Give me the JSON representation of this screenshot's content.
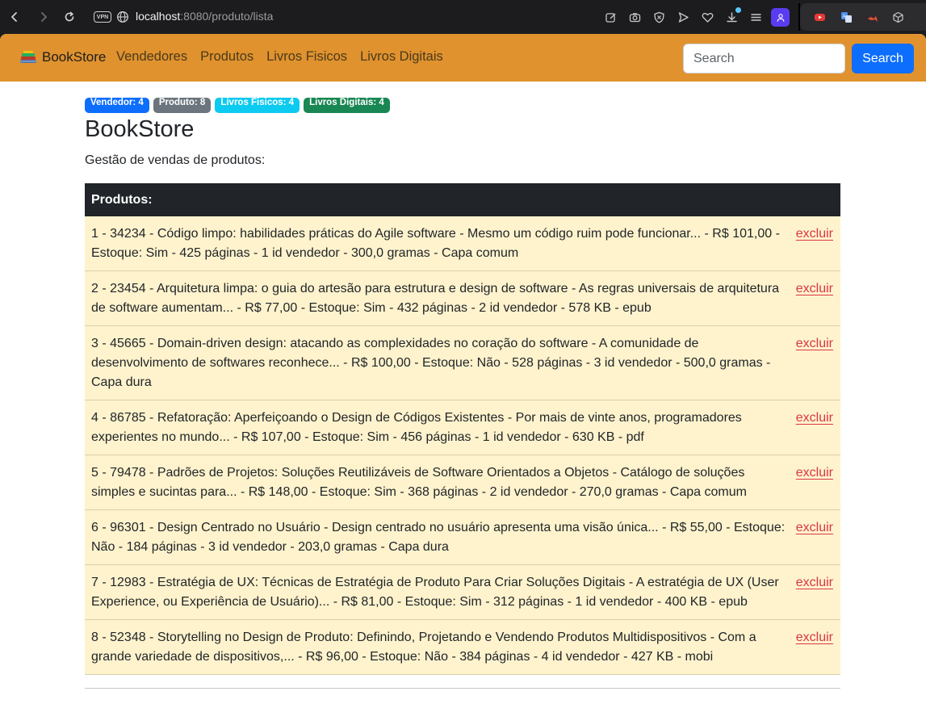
{
  "browser": {
    "vpn_label": "VPN",
    "url_host": "localhost",
    "url_rest": ":8080/produto/lista"
  },
  "navbar": {
    "brand": "BookStore",
    "links": [
      "Vendedores",
      "Produtos",
      "Livros Fisicos",
      "Livros Digitais"
    ],
    "search_placeholder": "Search",
    "search_button": "Search",
    "background": "#e0922e"
  },
  "badges": [
    {
      "label": "Vendedor: 4",
      "color": "#0d6efd"
    },
    {
      "label": "Produto: 8",
      "color": "#6c757d"
    },
    {
      "label": "Livros Fisicos: 4",
      "color": "#0dcaf0"
    },
    {
      "label": "Livros Digitais: 4",
      "color": "#198754"
    }
  ],
  "page": {
    "title": "BookStore",
    "subtitle": "Gestão de vendas de produtos:"
  },
  "table": {
    "header": "Produtos:",
    "delete_label": "excluir",
    "rows": [
      "1 - 34234 - Código limpo: habilidades práticas do Agile software - Mesmo um código ruim pode funcionar... - R$ 101,00 - Estoque: Sim - 425 páginas - 1 id vendedor - 300,0 gramas - Capa comum",
      "2 - 23454 - Arquitetura limpa: o guia do artesão para estrutura e design de software - As regras universais de arquitetura de software aumentam... - R$ 77,00 - Estoque: Sim - 432 páginas - 2 id vendedor - 578 KB - epub",
      "3 - 45665 - Domain-driven design: atacando as complexidades no coração do software - A comunidade de desenvolvimento de softwares reconhece... - R$ 100,00 - Estoque: Não - 528 páginas - 3 id vendedor - 500,0 gramas - Capa dura",
      "4 - 86785 - Refatoração: Aperfeiçoando o Design de Códigos Existentes - Por mais de vinte anos, programadores experientes no mundo... - R$ 107,00 - Estoque: Sim - 456 páginas - 1 id vendedor - 630 KB - pdf",
      "5 - 79478 - Padrões de Projetos: Soluções Reutilizáveis de Software Orientados a Objetos - Catálogo de soluções simples e sucintas para... - R$ 148,00 - Estoque: Sim - 368 páginas - 2 id vendedor - 270,0 gramas - Capa comum",
      "6 - 96301 - Design Centrado no Usuário - Design centrado no usuário apresenta uma visão única... - R$ 55,00 - Estoque: Não - 184 páginas - 3 id vendedor - 203,0 gramas - Capa dura",
      "7 - 12983 - Estratégia de UX: Técnicas de Estratégia de Produto Para Criar Soluções Digitais - A estratégia de UX (User Experience, ou Experiência de Usuário)... - R$ 81,00 - Estoque: Sim - 312 páginas - 1 id vendedor - 400 KB - epub",
      "8 - 52348 - Storytelling no Design de Produto: Definindo, Projetando e Vendendo Produtos Multidispositivos - Com a grande variedade de dispositivos,... - R$ 96,00 - Estoque: Não - 384 páginas - 4 id vendedor - 427 KB - mobi"
    ]
  }
}
